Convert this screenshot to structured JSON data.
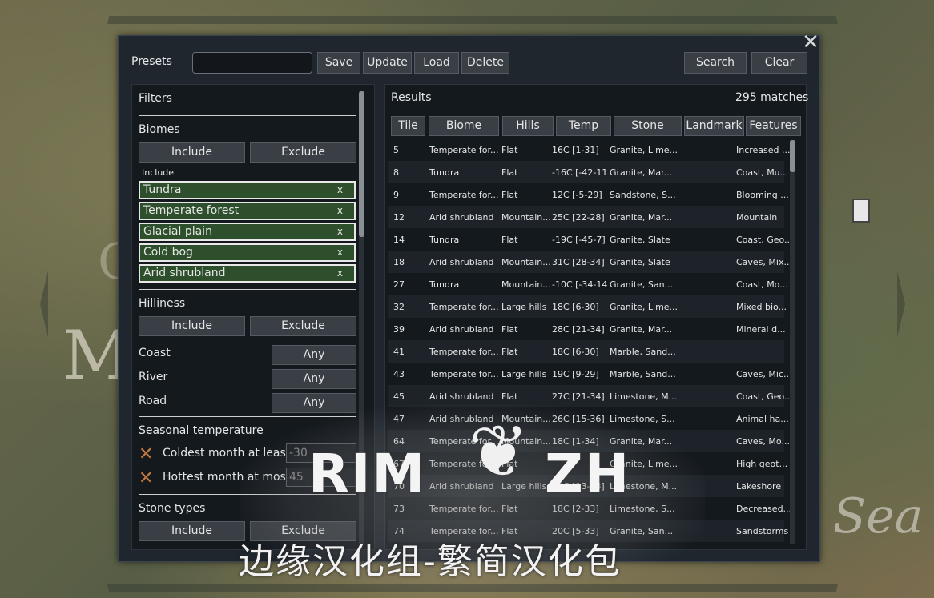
{
  "map": {
    "letter_c": "C",
    "letter_m": "M",
    "sea_text": "Sea"
  },
  "presets": {
    "label": "Presets",
    "input_value": "",
    "save": "Save",
    "update": "Update",
    "load": "Load",
    "delete": "Delete",
    "search": "Search",
    "clear": "Clear"
  },
  "filters": {
    "title": "Filters",
    "biomes": {
      "heading": "Biomes",
      "include": "Include",
      "exclude": "Exclude",
      "include_label": "Include",
      "chips": [
        "Tundra",
        "Temperate forest",
        "Glacial plain",
        "Cold bog",
        "Arid shrubland"
      ],
      "remove": "x"
    },
    "hilliness": {
      "heading": "Hilliness",
      "include": "Include",
      "exclude": "Exclude"
    },
    "coast": {
      "label": "Coast",
      "value": "Any"
    },
    "river": {
      "label": "River",
      "value": "Any"
    },
    "road": {
      "label": "Road",
      "value": "Any"
    },
    "seasonal": {
      "heading": "Seasonal temperature",
      "coldest_label": "Coldest month at least",
      "coldest_value": "-30",
      "hottest_label": "Hottest month at most",
      "hottest_value": "45"
    },
    "stone": {
      "heading": "Stone types",
      "include": "Include",
      "exclude": "Exclude"
    }
  },
  "results": {
    "title": "Results",
    "matches": "295 matches",
    "columns": [
      "Tile",
      "Biome",
      "Hills",
      "Temp",
      "Stone",
      "Landmark",
      "Features"
    ],
    "rows": [
      [
        "5",
        "Temperate for...",
        "Flat",
        "16C [1-31]",
        "Granite, Lime...",
        "",
        "Increased ..."
      ],
      [
        "8",
        "Tundra",
        "Flat",
        "-16C [-42-11]",
        "Granite, Mar...",
        "",
        "Coast, Mu..."
      ],
      [
        "9",
        "Temperate for...",
        "Flat",
        "12C [-5-29]",
        "Sandstone, S...",
        "",
        "Blooming ..."
      ],
      [
        "12",
        "Arid shrubland",
        "Mountain...",
        "25C [22-28]",
        "Granite, Mar...",
        "",
        "Mountain"
      ],
      [
        "14",
        "Tundra",
        "Flat",
        "-19C [-45-7]",
        "Granite, Slate",
        "",
        "Coast, Geo..."
      ],
      [
        "18",
        "Arid shrubland",
        "Mountain...",
        "31C [28-34]",
        "Granite, Slate",
        "",
        "Caves, Mix..."
      ],
      [
        "27",
        "Tundra",
        "Mountain...",
        "-10C [-34-14]",
        "Granite, San...",
        "",
        "Coast, Mo..."
      ],
      [
        "32",
        "Temperate for...",
        "Large hills",
        "18C [6-30]",
        "Granite, Lime...",
        "",
        "Mixed bio..."
      ],
      [
        "39",
        "Arid shrubland",
        "Flat",
        "28C [21-34]",
        "Granite, Mar...",
        "",
        "Mineral d..."
      ],
      [
        "41",
        "Temperate for...",
        "Flat",
        "18C [6-30]",
        "Marble, Sand...",
        "",
        ""
      ],
      [
        "43",
        "Temperate for...",
        "Large hills",
        "19C [9-29]",
        "Marble, Sand...",
        "",
        "Caves, Mic..."
      ],
      [
        "45",
        "Arid shrubland",
        "Flat",
        "27C [21-34]",
        "Limestone, M...",
        "",
        "Coast, Geo..."
      ],
      [
        "47",
        "Arid shrubland",
        "Mountain...",
        "26C [15-36]",
        "Limestone, S...",
        "",
        "Animal ha..."
      ],
      [
        "64",
        "Temperate for...",
        "Mountain...",
        "18C [1-34]",
        "Granite, Mar...",
        "",
        "Caves, Mo..."
      ],
      [
        "67",
        "Temperate for...",
        "Flat",
        "",
        "Granite, Lime...",
        "",
        "High geot..."
      ],
      [
        "70",
        "Arid shrubland",
        "Large hills",
        "26C [13-38]",
        "Limestone, M...",
        "",
        "Lakeshore"
      ],
      [
        "73",
        "Temperate for...",
        "Flat",
        "18C [2-33]",
        "Limestone, S...",
        "",
        "Decreased..."
      ],
      [
        "74",
        "Temperate for...",
        "Flat",
        "20C [5-33]",
        "Granite, San...",
        "",
        "Sandstorms"
      ]
    ]
  },
  "watermark": {
    "logo_left": "RIM",
    "logo_right": "ZH",
    "subtitle": "边缘汉化组-繁简汉化包"
  }
}
